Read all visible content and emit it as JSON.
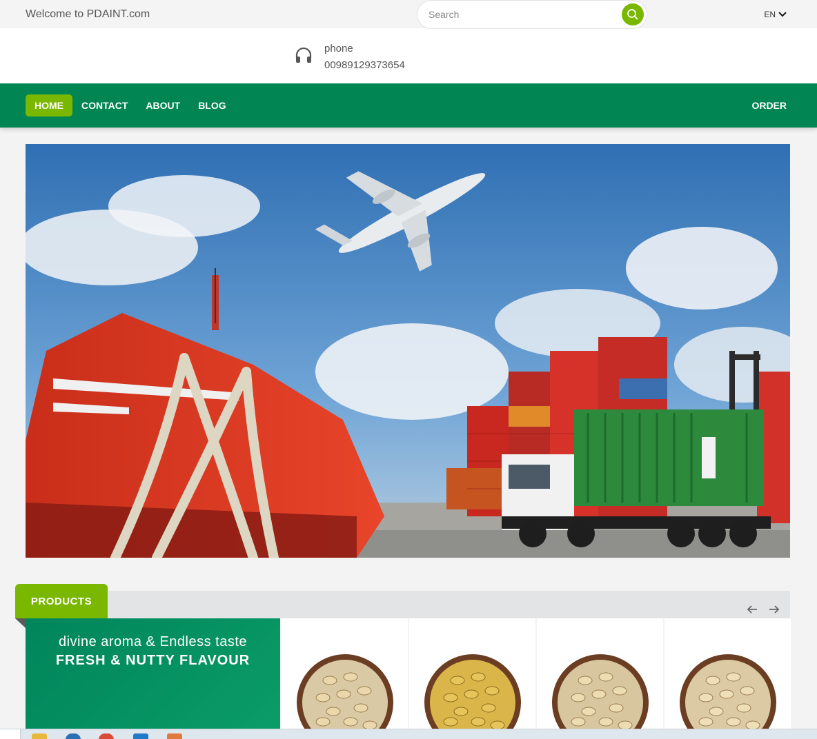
{
  "topbar": {
    "welcome": "Welcome to PDAINT.com",
    "language": "EN"
  },
  "header": {
    "phone_label": "phone",
    "phone_number": "00989129373654",
    "search_placeholder": "Search"
  },
  "nav": {
    "items": [
      {
        "label": "HOME",
        "active": true
      },
      {
        "label": "CONTACT",
        "active": false
      },
      {
        "label": "ABOUT",
        "active": false
      },
      {
        "label": "BLOG",
        "active": false
      }
    ],
    "order_label": "ORDER"
  },
  "products": {
    "tab_label": "PRODUCTS",
    "promo_line1": "divine aroma & Endless taste",
    "promo_line2": "FRESH & NUTTY FLAVOUR",
    "cards": [
      {
        "image": "pistachio-bowl"
      },
      {
        "image": "pistachio-bowl"
      },
      {
        "image": "pistachio-bowl"
      },
      {
        "image": "pistachio-bowl"
      }
    ]
  },
  "colors": {
    "brand_green": "#008553",
    "accent_lime": "#7ab800",
    "strip_gray": "#e3e4e6"
  }
}
